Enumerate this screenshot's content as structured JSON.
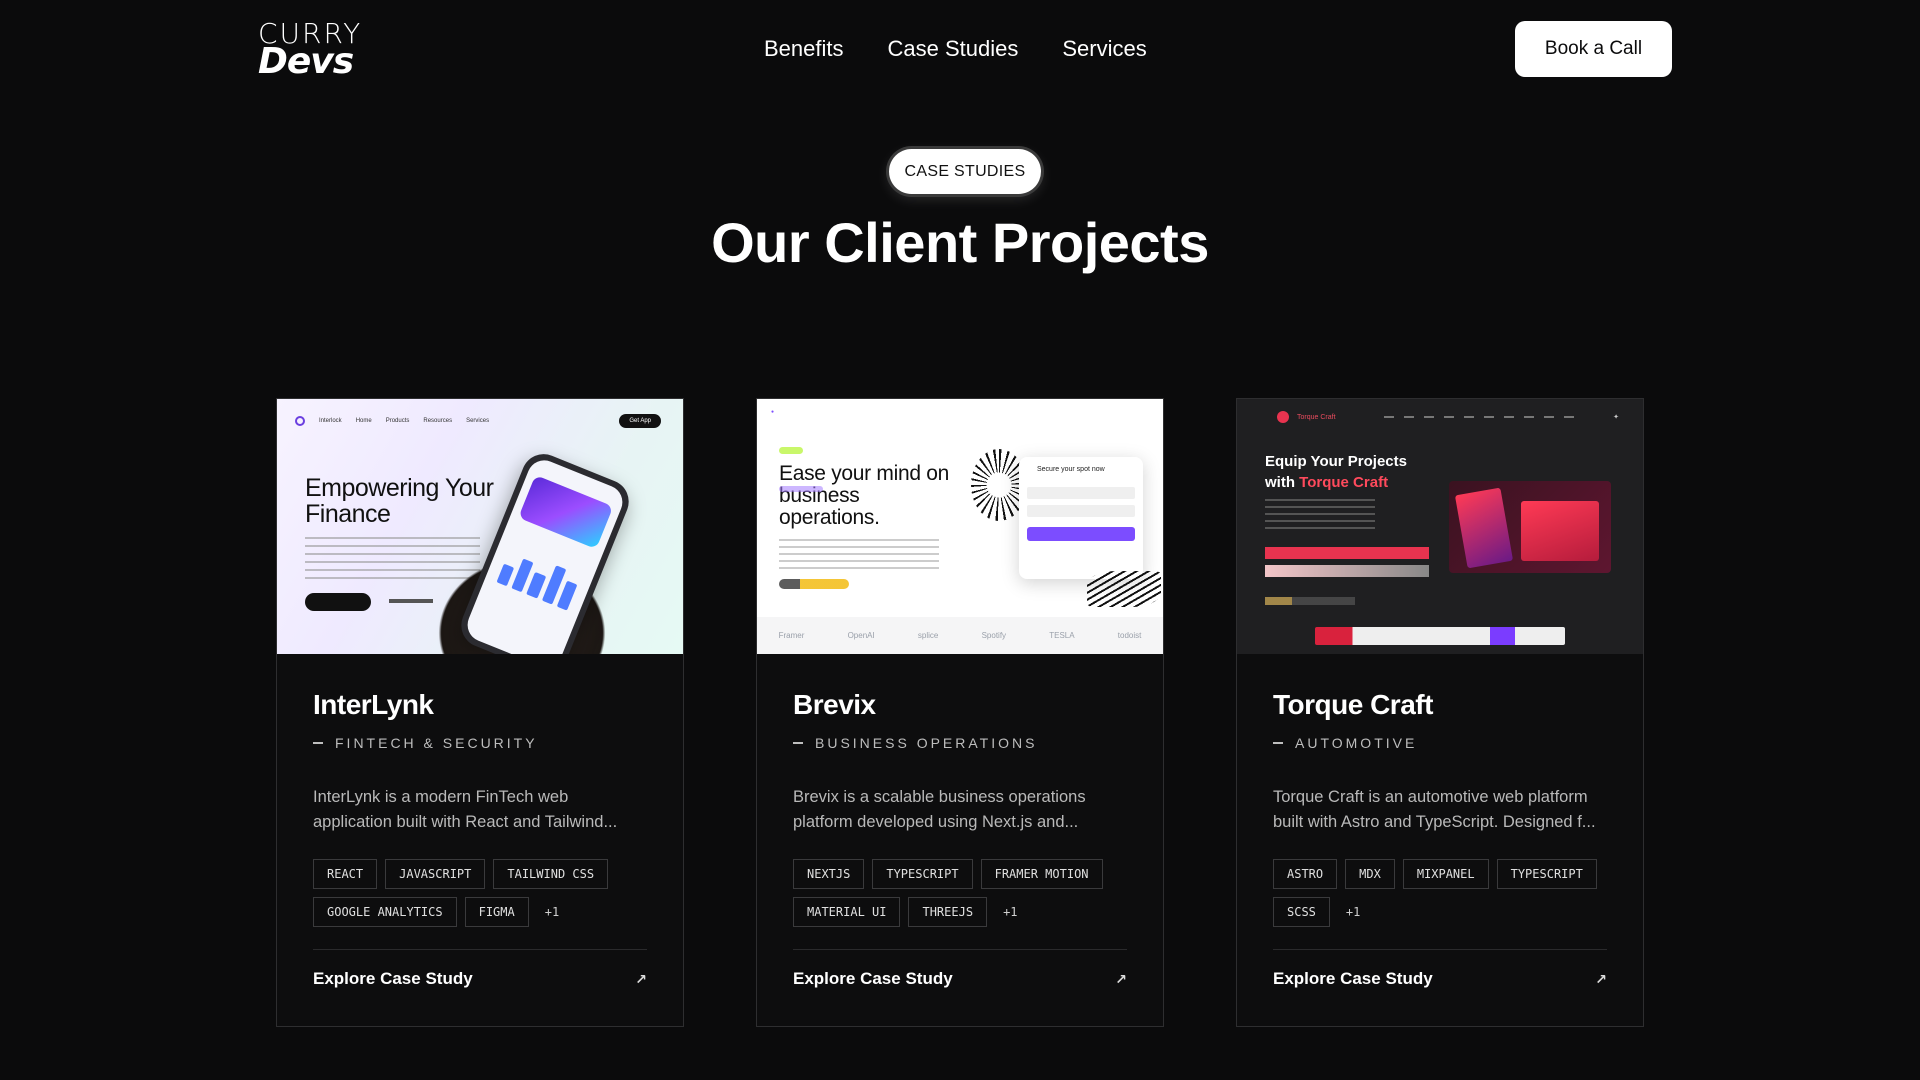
{
  "brand": {
    "line1": "CURRY",
    "line2": "Devs"
  },
  "nav": {
    "items": [
      "Benefits",
      "Case Studies",
      "Services"
    ]
  },
  "header": {
    "cta_label": "Book a Call"
  },
  "hero": {
    "pill": "CASE STUDIES",
    "title": "Our Client Projects"
  },
  "colors": {
    "background": "#0b0b0c",
    "accent_red": "#ff4a5c",
    "accent_purple": "#7c4dff"
  },
  "projects": [
    {
      "name": "InterLynk",
      "category": "FINTECH & SECURITY",
      "description": "InterLynk is a modern FinTech web application built with React and Tailwind...",
      "tags": [
        "REACT",
        "JAVASCRIPT",
        "TAILWIND CSS",
        "GOOGLE ANALYTICS",
        "FIGMA"
      ],
      "more": "+1",
      "cta": "Explore Case Study",
      "preview": {
        "headline": "Empowering Your Finance",
        "brand": "Interlock",
        "nav": [
          "Home",
          "Products",
          "Resources",
          "Services"
        ],
        "button": "Get App"
      }
    },
    {
      "name": "Brevix",
      "category": "BUSINESS OPERATIONS",
      "description": "Brevix is a scalable business operations platform developed using Next.js and...",
      "tags": [
        "NEXTJS",
        "TYPESCRIPT",
        "FRAMER MOTION",
        "MATERIAL UI",
        "THREEJS"
      ],
      "more": "+1",
      "cta": "Explore Case Study",
      "preview": {
        "headline": "Ease your mind on business operations.",
        "form_title": "Secure your spot now",
        "logos": [
          "Framer",
          "OpenAI",
          "splice",
          "Spotify",
          "TESLA",
          "todoist"
        ]
      }
    },
    {
      "name": "Torque Craft",
      "category": "AUTOMOTIVE",
      "description": "Torque Craft is an automotive web platform built with Astro and TypeScript. Designed f...",
      "tags": [
        "ASTRO",
        "MDX",
        "MIXPANEL",
        "TYPESCRIPT",
        "SCSS"
      ],
      "more": "+1",
      "cta": "Explore Case Study",
      "preview": {
        "headline_a": "Equip Your Projects",
        "headline_b": "with ",
        "headline_c": "Torque Craft",
        "brand": "Torque Craft"
      }
    }
  ]
}
